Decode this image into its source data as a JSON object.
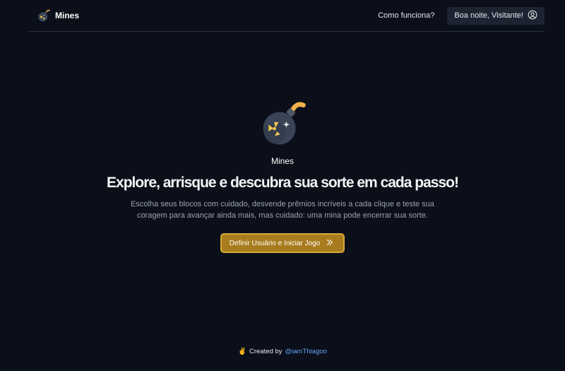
{
  "header": {
    "brand_name": "Mines",
    "nav_link": "Como funciona?",
    "user_button_label": "Boa noite, Visitante!"
  },
  "hero": {
    "title": "Mines",
    "headline": "Explore, arrisque e descubra sua sorte em cada passo!",
    "description": "Escolha seus blocos com cuidado, desvende prêmios incríveis a cada clique e teste sua coragem para avançar ainda mais, mas cuidado: uma mina pode encerrar sua sorte.",
    "cta_label": "Definir Usuário e Iniciar Jogo"
  },
  "footer": {
    "emoji": "✌️",
    "created_by": "Created by",
    "author_link": "@iamThiagoo"
  },
  "icons": {
    "logo": "bomb-icon",
    "user": "user-circle-icon",
    "cta": "double-chevron-right-icon"
  },
  "colors": {
    "background": "#0b0f19",
    "accent": "#a87c1e",
    "accent_border": "#d6a83a",
    "link": "#60a5fa"
  }
}
